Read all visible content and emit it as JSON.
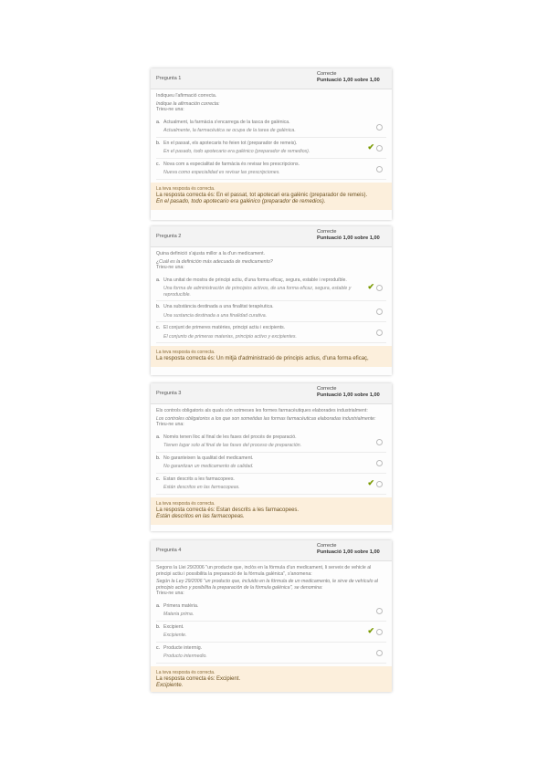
{
  "questions": [
    {
      "title": "Pregunta 1",
      "status": "Correcte",
      "score": "Puntuació 1,00 sobre 1,00",
      "text": "Indiqueu l'afirmació correcta.",
      "text_es": "Indique la afirmación correcta:",
      "choose": "Trieu-ne una:",
      "options": [
        {
          "letter": "a.",
          "ca": "Actualment, la farmàcia s'encarrega de la tasca de galènica.",
          "es": "Actualmente, la farmacéutica se ocupa de la tarea de galénica."
        },
        {
          "letter": "b.",
          "ca": "En el passat, els apotecaris ho feien tot (preparador de remeis).",
          "es": "En el pasado, todo apotecario era galénico (preparador de remedios)."
        },
        {
          "letter": "c.",
          "ca": "Nova com a especialitat de farmàcia és revisar les prescripcions.",
          "es": "Nueva como especialidad es revisar las prescripciones."
        }
      ],
      "feedback_label": "La teva resposta és correcta.",
      "answer": "La resposta correcta és: En el passat, tot apotecari era galènic (preparador de remeis).",
      "answer_es": "En el pasado, todo apotecario era galénico (preparador de remedios)."
    },
    {
      "title": "Pregunta 2",
      "status": "Correcte",
      "score": "Puntuació 1,00 sobre 1,00",
      "text": "Quina definició s'ajusta millor a la d'un medicament.",
      "text_es": "¿Cuál es la definición más adecuada de medicamento?",
      "choose": "Trieu-ne una:",
      "options": [
        {
          "letter": "a.",
          "ca": "Una unitat de mostra de principi actiu, d'una forma eficaç, segura, estable i reproduïble.",
          "es": "Una forma de administración de principios activos, de una forma eficaz, segura, estable y reproducible."
        },
        {
          "letter": "b.",
          "ca": "Una substància destinada a una finalitat terapèutica.",
          "es": "Una sustancia destinada a una finalidad curativa."
        },
        {
          "letter": "c.",
          "ca": "El conjunt de primeres matèries, principi actiu i excipients.",
          "es": "El conjunto de primeras materias, principio activo y excipientes."
        }
      ],
      "feedback_label": "La teva resposta és correcta.",
      "answer": "La resposta correcta és: Un mitjà d'administració de principis actius, d'una forma eficaç,",
      "answer_es": ""
    },
    {
      "title": "Pregunta 3",
      "status": "Correcte",
      "score": "Puntuació 1,00 sobre 1,00",
      "text": "Els controls obligatoris als quals són sotmeses les formes farmacèutiques elaborades industrialment:",
      "text_es": "Los controles obligatorios a los que son sometidas las formas farmacéuticas elaboradas industrialmente:",
      "choose": "Trieu-ne una:",
      "options": [
        {
          "letter": "a.",
          "ca": "Només tenen lloc al final de les fases del procés de preparació.",
          "es": "Tienen lugar solo al final de las fases del proceso de preparación."
        },
        {
          "letter": "b.",
          "ca": "No garanteixen la qualitat del medicament.",
          "es": "No garantizan un medicamento de calidad."
        },
        {
          "letter": "c.",
          "ca": "Estan descrits a les farmacopees.",
          "es": "Están descritos en las farmacopeas."
        }
      ],
      "feedback_label": "La teva resposta és correcta.",
      "answer": "La resposta correcta és: Estan descrits a les farmacopees.",
      "answer_es": "Están descritos en las farmacopeas."
    },
    {
      "title": "Pregunta 4",
      "status": "Correcte",
      "score": "Puntuació 1,00 sobre 1,00",
      "text": "Segons la Llei 29/2006 \"un producte que, inclòs en la fórmula d'un medicament, li serveix de vehicle al principi actiu i possibilita la preparació de la fórmula galènica\", s'anomena:",
      "text_es": "Según la Ley 29/2006 \"un producto que, incluido en la fórmula de un medicamento, le sirve de vehículo al principio activo y posibilita la preparación de la fórmula galénica\", se denomina:",
      "choose": "Trieu-ne una:",
      "options": [
        {
          "letter": "a.",
          "ca": "Primera matèria.",
          "es": "Materia prima."
        },
        {
          "letter": "b.",
          "ca": "Excipient.",
          "es": "Excipiente."
        },
        {
          "letter": "c.",
          "ca": "Producte intermig.",
          "es": "Producto intermedio."
        }
      ],
      "feedback_label": "La teva resposta és correcta.",
      "answer": "La resposta correcta és: Excipient.",
      "answer_es": "Excipiente."
    }
  ],
  "colors": {
    "check": "#7a9a01",
    "feedback_bg": "#fcefdc"
  },
  "icons": {
    "check": "checkmark-icon",
    "radio": "radio-button-icon"
  }
}
